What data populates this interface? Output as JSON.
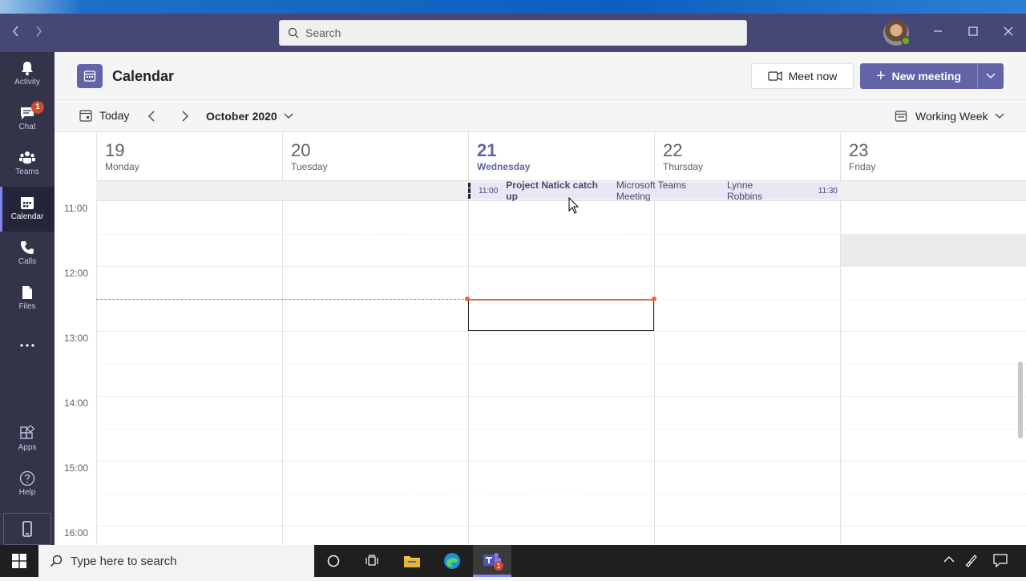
{
  "titlebar": {
    "search_placeholder": "Search",
    "back_icon": "chevron-left-icon",
    "forward_icon": "chevron-right-icon"
  },
  "rail": {
    "items": [
      {
        "label": "Activity",
        "icon": "bell-icon"
      },
      {
        "label": "Chat",
        "icon": "chat-icon",
        "badge": "1"
      },
      {
        "label": "Teams",
        "icon": "teams-icon"
      },
      {
        "label": "Calendar",
        "icon": "calendar-icon",
        "active": true
      },
      {
        "label": "Calls",
        "icon": "phone-icon"
      },
      {
        "label": "Files",
        "icon": "file-icon"
      },
      {
        "label": "",
        "icon": "more-icon"
      },
      {
        "label": "Apps",
        "icon": "apps-icon"
      },
      {
        "label": "Help",
        "icon": "help-icon"
      }
    ]
  },
  "header": {
    "title": "Calendar",
    "meet_now": "Meet now",
    "new_meeting": "New meeting"
  },
  "toolbar": {
    "today": "Today",
    "month": "October 2020",
    "view": "Working Week"
  },
  "days": [
    {
      "num": "19",
      "name": "Monday"
    },
    {
      "num": "20",
      "name": "Tuesday"
    },
    {
      "num": "21",
      "name": "Wednesday",
      "today": true
    },
    {
      "num": "22",
      "name": "Thursday"
    },
    {
      "num": "23",
      "name": "Friday"
    }
  ],
  "event": {
    "start": "11:00",
    "title": "Project Natick catch up",
    "location": "Microsoft Teams Meeting",
    "organizer": "Lynne Robbins",
    "end": "11:30"
  },
  "times": [
    "11:00",
    "12:00",
    "13:00",
    "14:00",
    "15:00",
    "16:00"
  ],
  "taskbar": {
    "search_placeholder": "Type here to search",
    "teams_badge": "1"
  },
  "colors": {
    "brand": "#6264a7",
    "rail": "#33344a",
    "titlebar": "#464775",
    "now_line": "#e8663a"
  }
}
